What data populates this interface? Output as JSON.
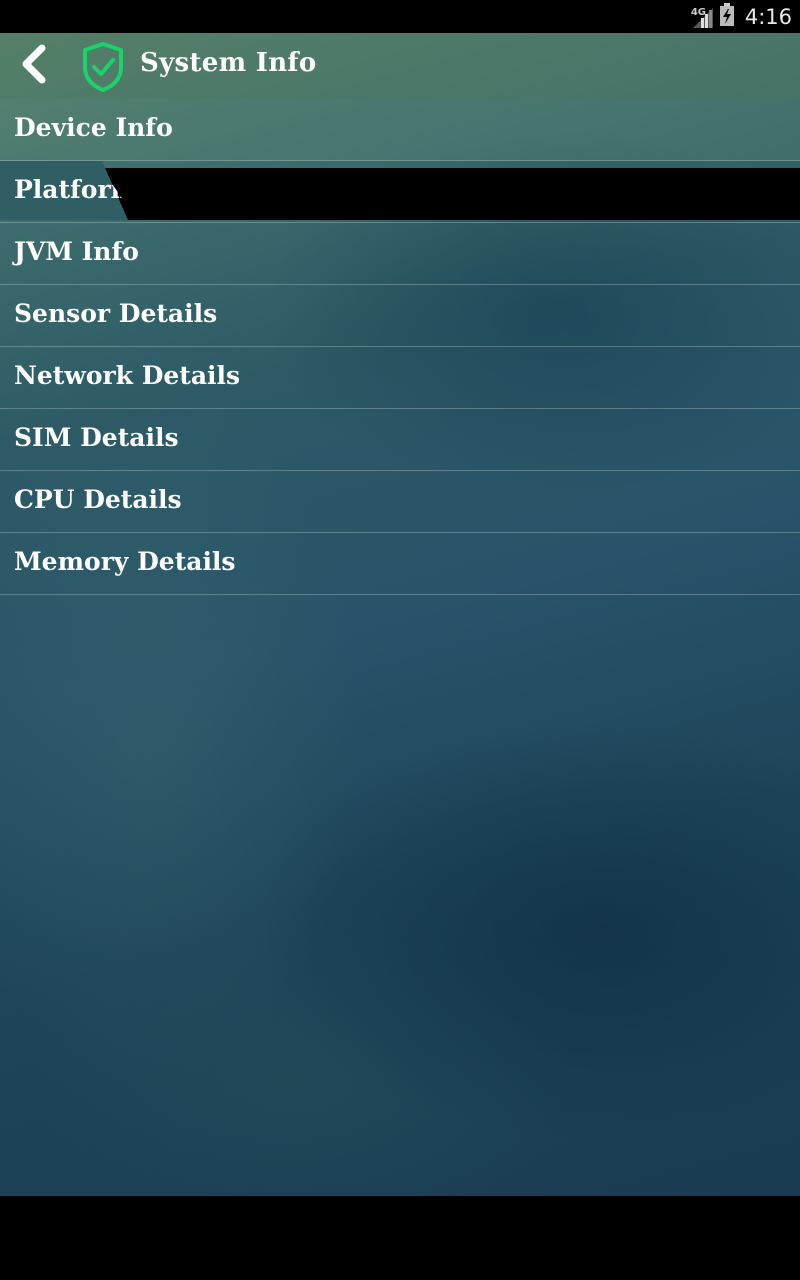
{
  "status_bar": {
    "network_type": "4G",
    "time": "4:16",
    "icons": [
      "signal-icon",
      "battery-icon"
    ]
  },
  "toolbar": {
    "title": "System Info",
    "back_icon": "chevron-left-icon",
    "app_icon": "shield-check-icon",
    "accent_color": "#19d36b"
  },
  "menu": {
    "items": [
      {
        "label": "Device Info"
      },
      {
        "label": "Platform"
      },
      {
        "label": "JVM Info"
      },
      {
        "label": "Sensor Details"
      },
      {
        "label": "Network Details"
      },
      {
        "label": "SIM Details"
      },
      {
        "label": "CPU Details"
      },
      {
        "label": "Memory Details"
      }
    ],
    "selected_index": 1
  }
}
